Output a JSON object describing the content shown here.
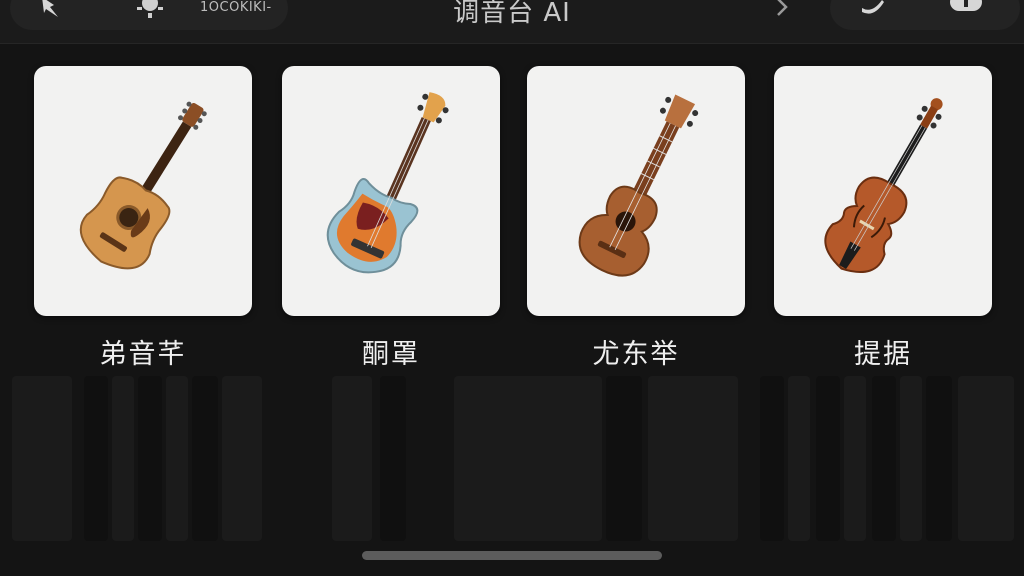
{
  "header": {
    "brand_text": "1OCOKIKI-",
    "title": "调音台 AI"
  },
  "instruments": [
    {
      "label": "弟音芊",
      "kind": "acoustic-guitar"
    },
    {
      "label": "酮罩",
      "kind": "bass-guitar"
    },
    {
      "label": "尤东举",
      "kind": "ukulele"
    },
    {
      "label": "提据",
      "kind": "violin"
    }
  ],
  "colors": {
    "background": "#141414",
    "card": "#f2f2f1",
    "label": "#efefef"
  }
}
